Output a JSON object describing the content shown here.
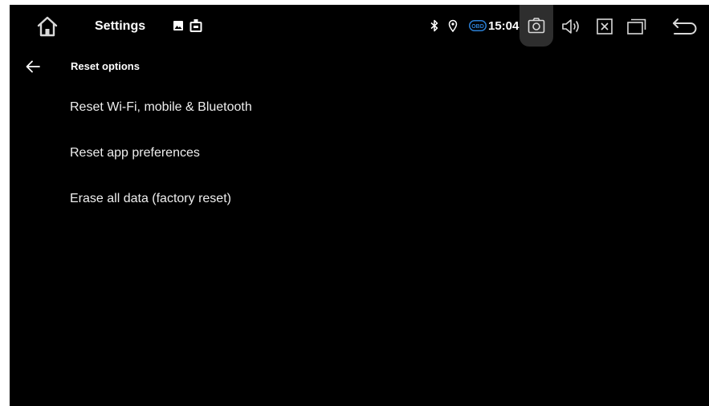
{
  "status_bar": {
    "app_title": "Settings",
    "time": "15:04",
    "icons": {
      "home": "home-icon",
      "notification_image": "image-icon",
      "notification_usb": "usb-device-icon",
      "bluetooth": "bluetooth-icon",
      "location": "location-pin-icon",
      "obd": "obd-icon",
      "obd_text": "OBD",
      "screenshot": "camera-icon",
      "volume": "volume-icon",
      "close": "close-box-icon",
      "recent": "recent-apps-icon",
      "back": "back-return-icon"
    }
  },
  "toolbar": {
    "back_icon": "arrow-left-icon",
    "title": "Reset options"
  },
  "options": [
    {
      "label": "Reset Wi-Fi, mobile & Bluetooth"
    },
    {
      "label": "Reset app preferences"
    },
    {
      "label": "Erase all data (factory reset)"
    }
  ],
  "colors": {
    "background": "#000000",
    "text_primary": "#eeeeee",
    "accent_obd": "#2b7fd4",
    "screenshot_highlight": "#2e2e2e"
  }
}
